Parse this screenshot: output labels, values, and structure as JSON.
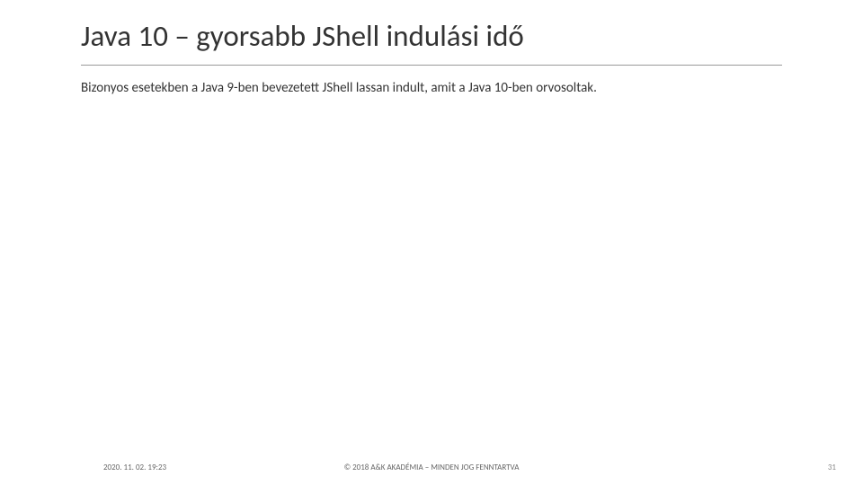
{
  "slide": {
    "title": "Java 10 – gyorsabb JShell indulási idő",
    "body": "Bizonyos esetekben a Java 9-ben bevezetett JShell lassan indult, amit a Java 10-ben orvosoltak."
  },
  "footer": {
    "timestamp": "2020. 11. 02. 19:23",
    "copyright": "© 2018 A&K AKADÉMIA – MINDEN JOG FENNTARTVA",
    "page_number": "31"
  }
}
